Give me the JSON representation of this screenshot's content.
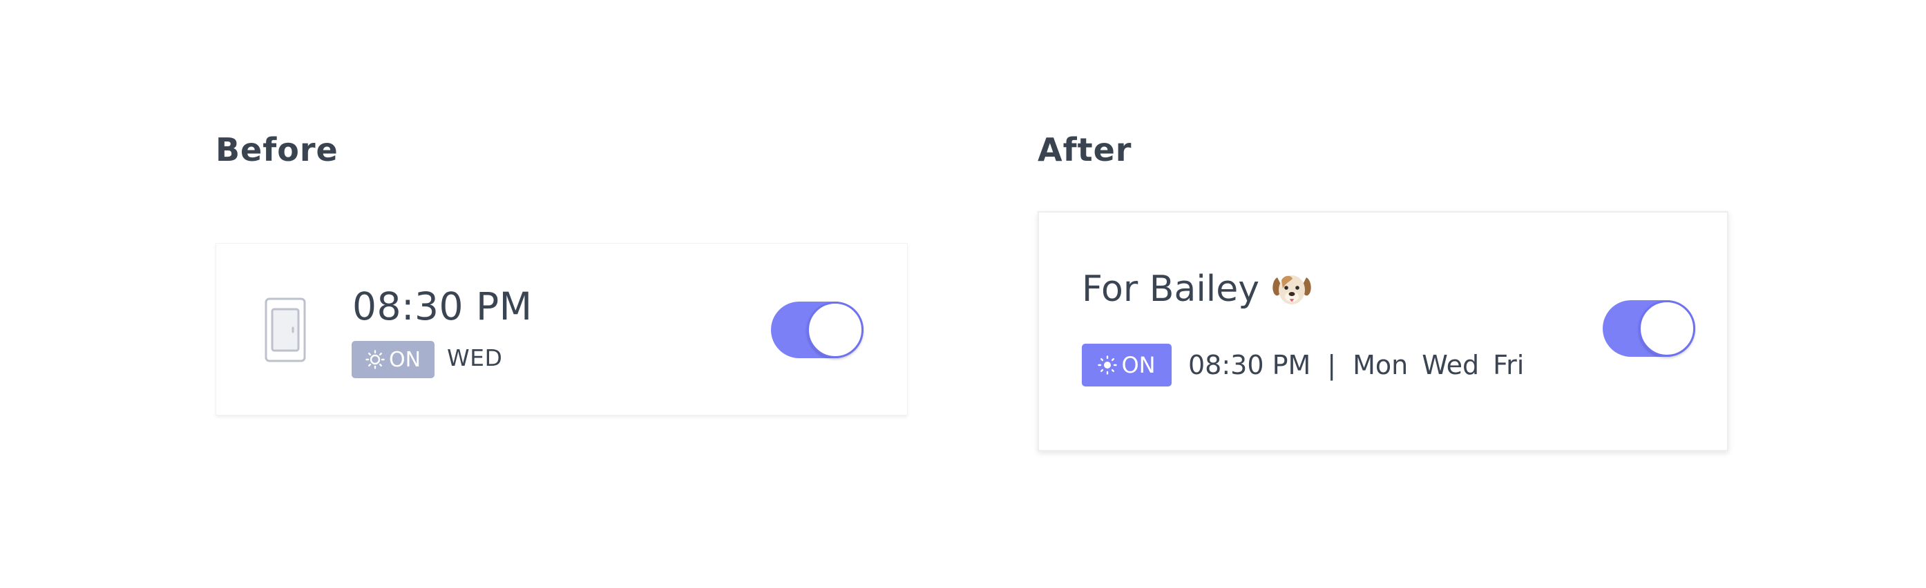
{
  "before": {
    "heading": "Before",
    "time": "08:30 PM",
    "badge_label": "ON",
    "day": "WED",
    "toggle_on": true,
    "icon": "door-icon"
  },
  "after": {
    "heading": "After",
    "title": "For Bailey",
    "title_icon": "dog-face-icon",
    "badge_label": "ON",
    "time": "08:30 PM",
    "separator": "|",
    "days": [
      "Mon",
      "Wed",
      "Fri"
    ],
    "toggle_on": true
  },
  "colors": {
    "accent": "#7c80f7",
    "badge_inactive": "#a7b0cd",
    "text": "#3a4452"
  }
}
